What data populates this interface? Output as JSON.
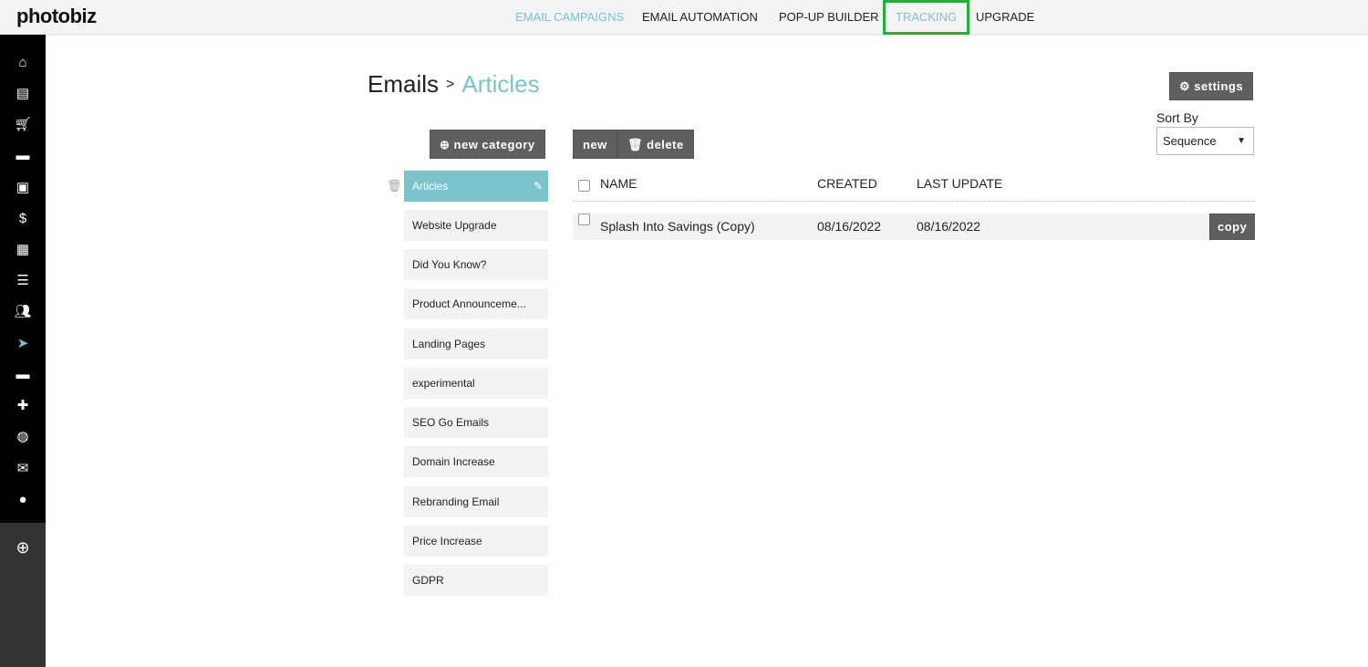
{
  "logo": "photobiz",
  "nav": [
    {
      "label": "EMAIL CAMPAIGNS"
    },
    {
      "label": "EMAIL AUTOMATION"
    },
    {
      "label": "POP-UP BUILDER"
    },
    {
      "label": "TRACKING"
    },
    {
      "label": "UPGRADE"
    }
  ],
  "sidebar": {
    "icons": [
      "home-icon",
      "website-icon",
      "cart-icon",
      "comment-icon",
      "gallery-icon",
      "invoice-icon",
      "calendar-icon",
      "list-icon",
      "contacts-icon",
      "send-icon",
      "folder-icon",
      "plugin-icon",
      "globe-icon",
      "mail-icon",
      "account-icon"
    ],
    "add_icon": "plus-circle-icon",
    "active_color": "#7ac3cc"
  },
  "breadcrumb": {
    "root": "Emails",
    "sep": ">",
    "current": "Articles"
  },
  "settings_label": "settings",
  "sort": {
    "label": "Sort By",
    "value": "Sequence"
  },
  "buttons": {
    "new_category": "new category",
    "new": "new",
    "delete": "delete",
    "copy": "copy"
  },
  "categories": [
    "Articles",
    "Website Upgrade",
    "Did You Know?",
    "Product Announceme...",
    "Landing Pages",
    "experimental",
    "SEO Go Emails",
    "Domain Increase",
    "Rebranding Email",
    "Price Increase",
    "GDPR"
  ],
  "table": {
    "headers": {
      "name": "NAME",
      "created": "CREATED",
      "updated": "LAST UPDATE"
    },
    "rows": [
      {
        "name": "Splash Into Savings (Copy)",
        "created": "08/16/2022",
        "updated": "08/16/2022"
      }
    ]
  },
  "colors": {
    "accent": "#7ac3cc",
    "highlight": "#1db33a",
    "button": "#5f5f5f"
  }
}
